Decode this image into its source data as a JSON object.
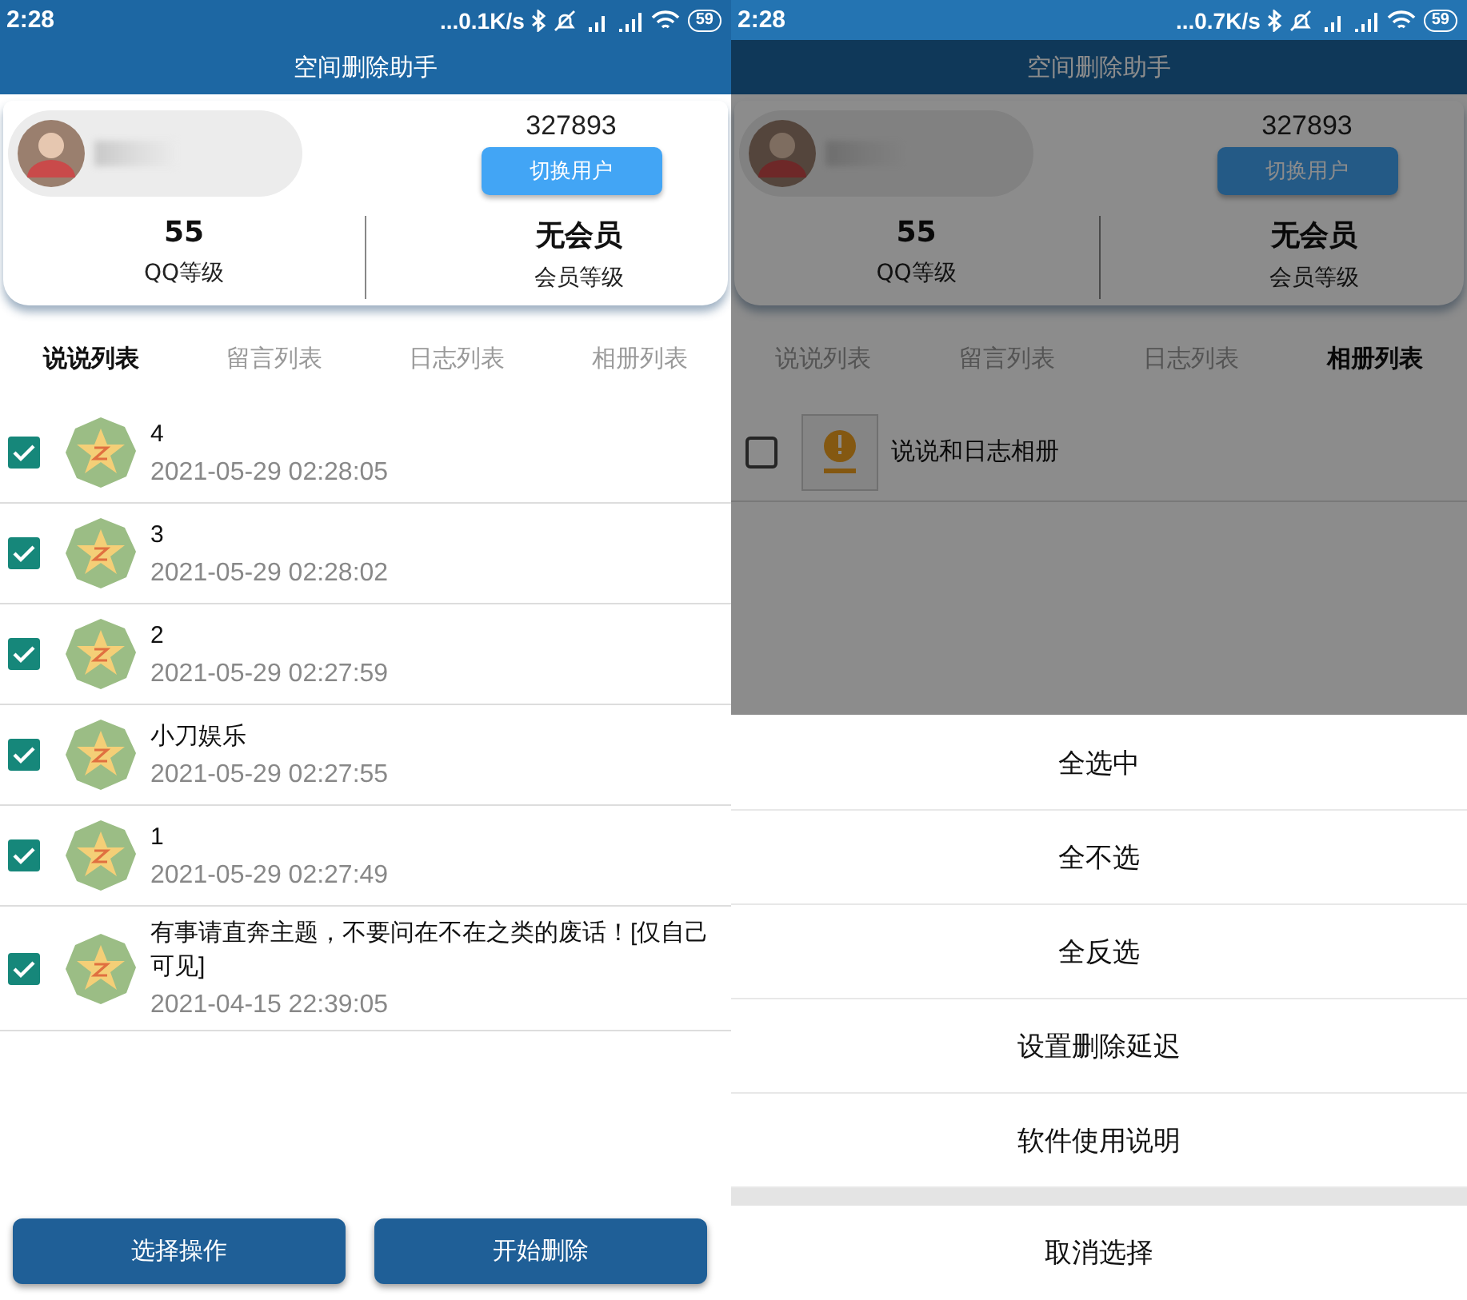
{
  "screens": [
    {
      "status_bar": {
        "time": "2:28",
        "net_speed": "...0.1K/s",
        "battery": "59"
      },
      "title": "空间删除助手",
      "profile": {
        "qq_number": "327893",
        "switch_button": "切换用户",
        "level": "55",
        "level_label": "QQ等级",
        "vip": "无会员",
        "vip_label": "会员等级"
      },
      "tabs": [
        {
          "label": "说说列表",
          "selected": true
        },
        {
          "label": "留言列表",
          "selected": false
        },
        {
          "label": "日志列表",
          "selected": false
        },
        {
          "label": "相册列表",
          "selected": false
        }
      ],
      "items": [
        {
          "kind": "post",
          "text": "4",
          "time": "2021-05-29 02:28:05",
          "checked": true
        },
        {
          "kind": "post",
          "text": "3",
          "time": "2021-05-29 02:28:02",
          "checked": true
        },
        {
          "kind": "post",
          "text": "2",
          "time": "2021-05-29 02:27:59",
          "checked": true
        },
        {
          "kind": "post",
          "text": "小刀娱乐",
          "time": "2021-05-29 02:27:55",
          "checked": true
        },
        {
          "kind": "post",
          "text": "1",
          "time": "2021-05-29 02:27:49",
          "checked": true
        },
        {
          "kind": "post",
          "text": "有事请直奔主题，不要问在不在之类的废话！[仅自己可见]",
          "time": "2021-04-15 22:39:05",
          "checked": true
        }
      ],
      "buttons": [
        "选择操作",
        "开始删除"
      ]
    },
    {
      "status_bar": {
        "time": "2:28",
        "net_speed": "...0.7K/s",
        "battery": "59"
      },
      "title": "空间删除助手",
      "profile": {
        "qq_number": "327893",
        "switch_button": "切换用户",
        "level": "55",
        "level_label": "QQ等级",
        "vip": "无会员",
        "vip_label": "会员等级"
      },
      "tabs": [
        {
          "label": "说说列表",
          "selected": false
        },
        {
          "label": "留言列表",
          "selected": false
        },
        {
          "label": "日志列表",
          "selected": false
        },
        {
          "label": "相册列表",
          "selected": true
        }
      ],
      "items": [
        {
          "kind": "album",
          "text": "说说和日志相册",
          "checked": false
        }
      ],
      "action_sheet": {
        "options": [
          "全选中",
          "全不选",
          "全反选",
          "设置删除延迟",
          "软件使用说明"
        ],
        "cancel": "取消选择"
      }
    }
  ]
}
